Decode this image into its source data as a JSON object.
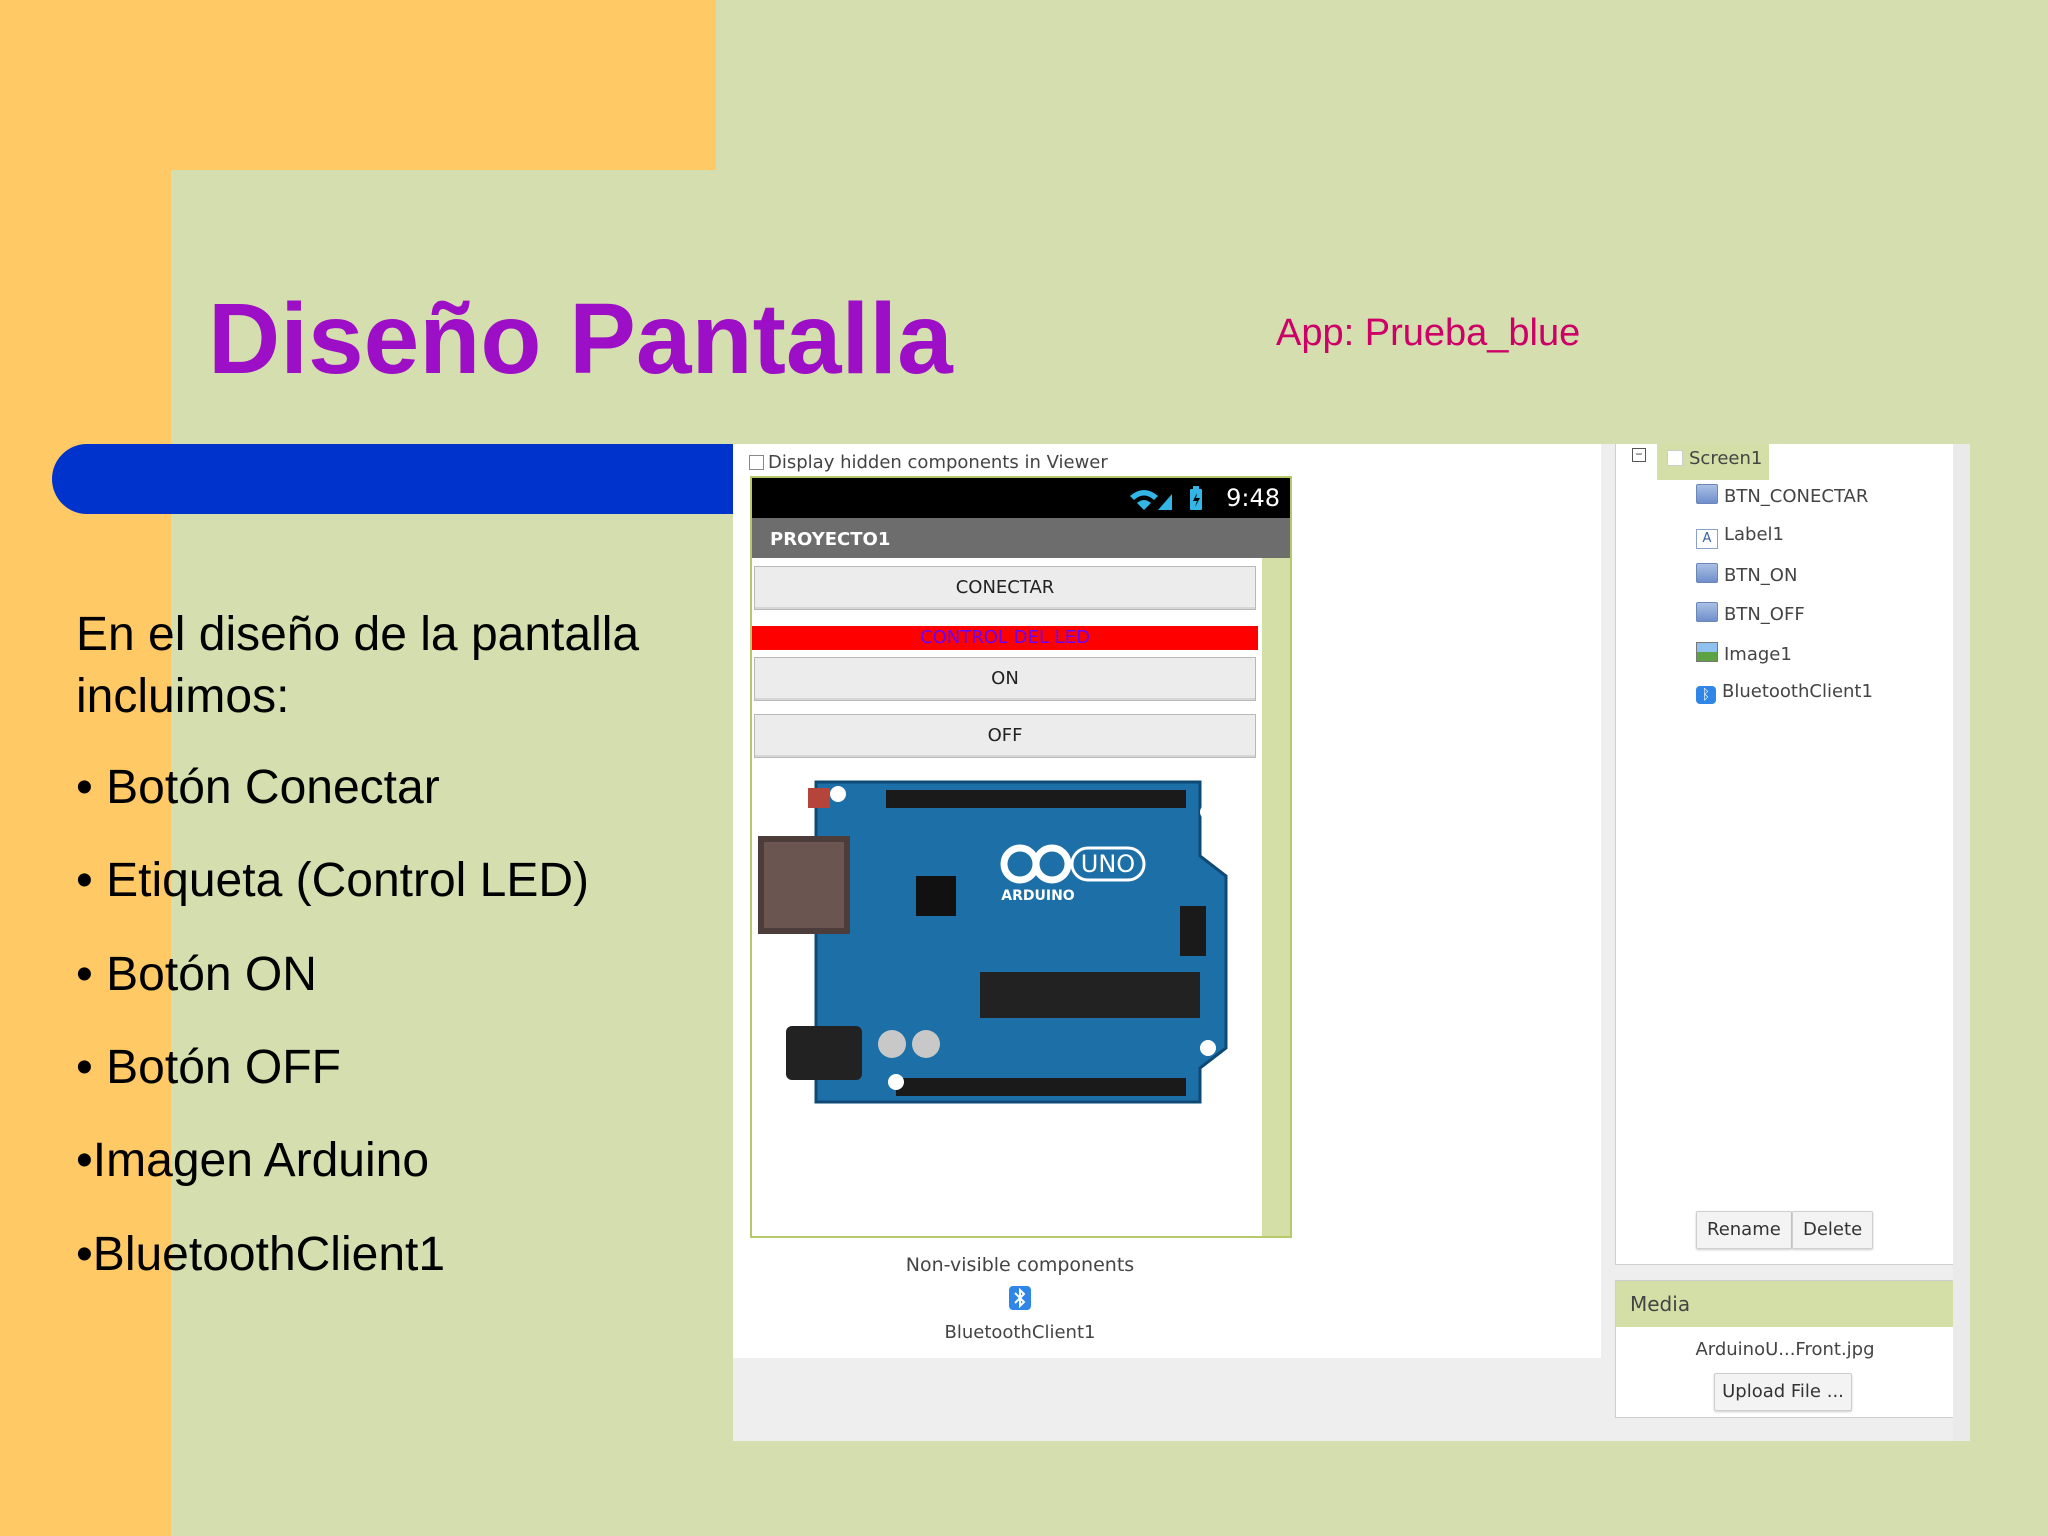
{
  "slide": {
    "title": "Diseño Pantalla",
    "app_label": "App: Prueba_blue",
    "intro": "En el diseño de la pantalla incluimos:",
    "bullets": [
      "• Botón Conectar",
      "• Etiqueta (Control LED)",
      "• Botón ON",
      "• Botón OFF",
      "•Imagen Arduino",
      "•BluetoothClient1"
    ]
  },
  "viewer": {
    "display_hidden_label": "Display hidden components in Viewer",
    "status_time": "9:48",
    "project_title": "PROYECTO1",
    "btn_conectar": "CONECTAR",
    "label_led": "CONTROL DEL LED",
    "btn_on": "ON",
    "btn_off": "OFF",
    "nonvisible_title": "Non-visible components",
    "nonvisible_item": "BluetoothClient1"
  },
  "components": {
    "root": "Screen1",
    "items": [
      "BTN_CONECTAR",
      "Label1",
      "BTN_ON",
      "BTN_OFF",
      "Image1",
      "BluetoothClient1"
    ],
    "rename_label": "Rename",
    "delete_label": "Delete"
  },
  "media": {
    "title": "Media",
    "file": "ArduinoU...Front.jpg",
    "upload_label": "Upload File ..."
  },
  "colors": {
    "title": "#9c0fc6",
    "app_label": "#cc0066",
    "blue_bar": "#0033cc",
    "orange": "#ffc966",
    "green": "#d5deae",
    "label_bg": "#ff0000",
    "label_text": "#6600ff"
  }
}
